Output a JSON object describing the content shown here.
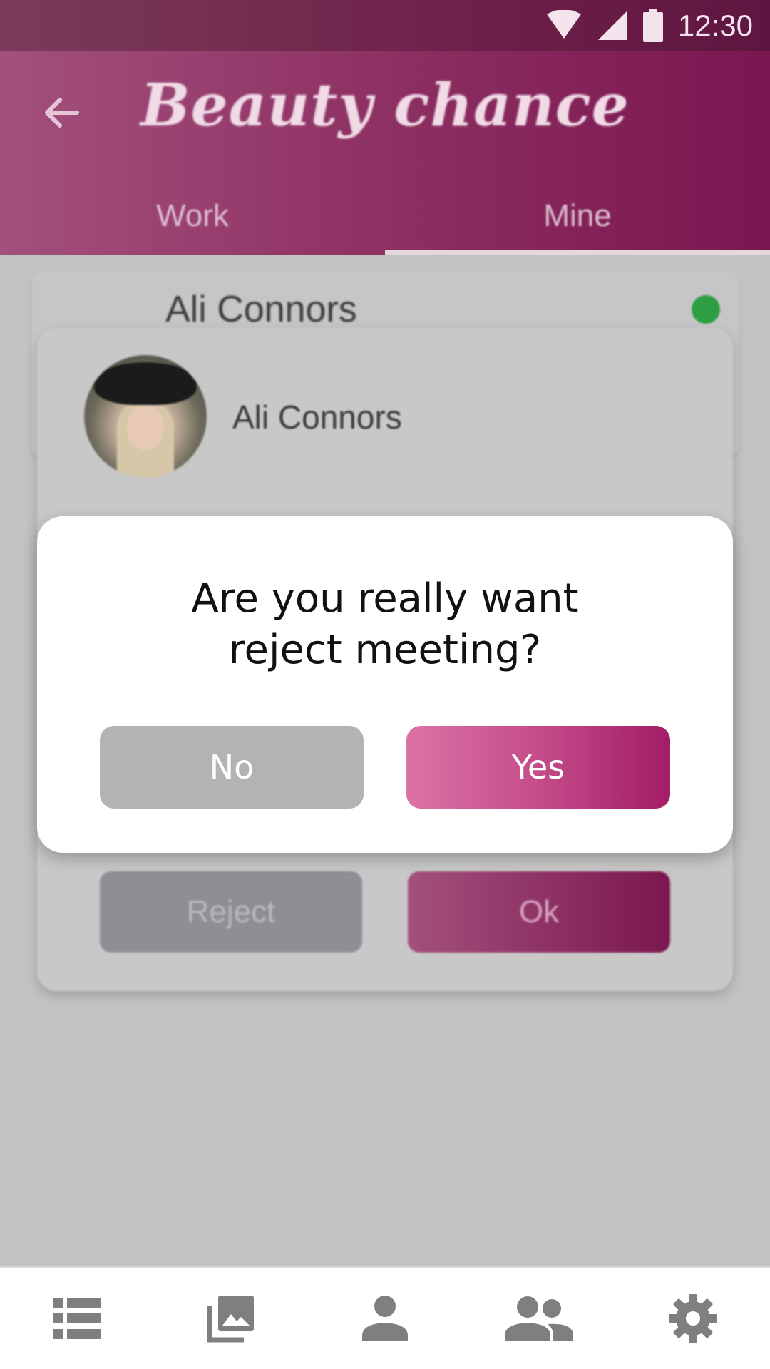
{
  "status_bar": {
    "time": "12:30",
    "icons": [
      "wifi-icon",
      "signal-icon",
      "battery-icon"
    ]
  },
  "app_bar": {
    "title": "Beauty chance",
    "back_icon": "arrow-back-icon"
  },
  "tabs": [
    {
      "label": "Work"
    },
    {
      "label": "Mine",
      "selected": true
    }
  ],
  "background_card": {
    "name": "Ali Connors",
    "status_color": "#2e9e43"
  },
  "profile": {
    "name": "Ali Connors"
  },
  "background_actions": {
    "reject_label": "Reject",
    "ok_label": "Ok"
  },
  "dialog": {
    "message_line1": "Are you really want",
    "message_line2": "reject meeting?",
    "no_label": "No",
    "yes_label": "Yes"
  },
  "bottom_nav": [
    {
      "icon": "list-icon"
    },
    {
      "icon": "gallery-icon"
    },
    {
      "icon": "person-icon"
    },
    {
      "icon": "group-icon"
    },
    {
      "icon": "settings-icon"
    }
  ],
  "colors": {
    "accent": "#a31d66",
    "accent_light": "#dd72a6",
    "button_gray": "#b3b3b3"
  }
}
